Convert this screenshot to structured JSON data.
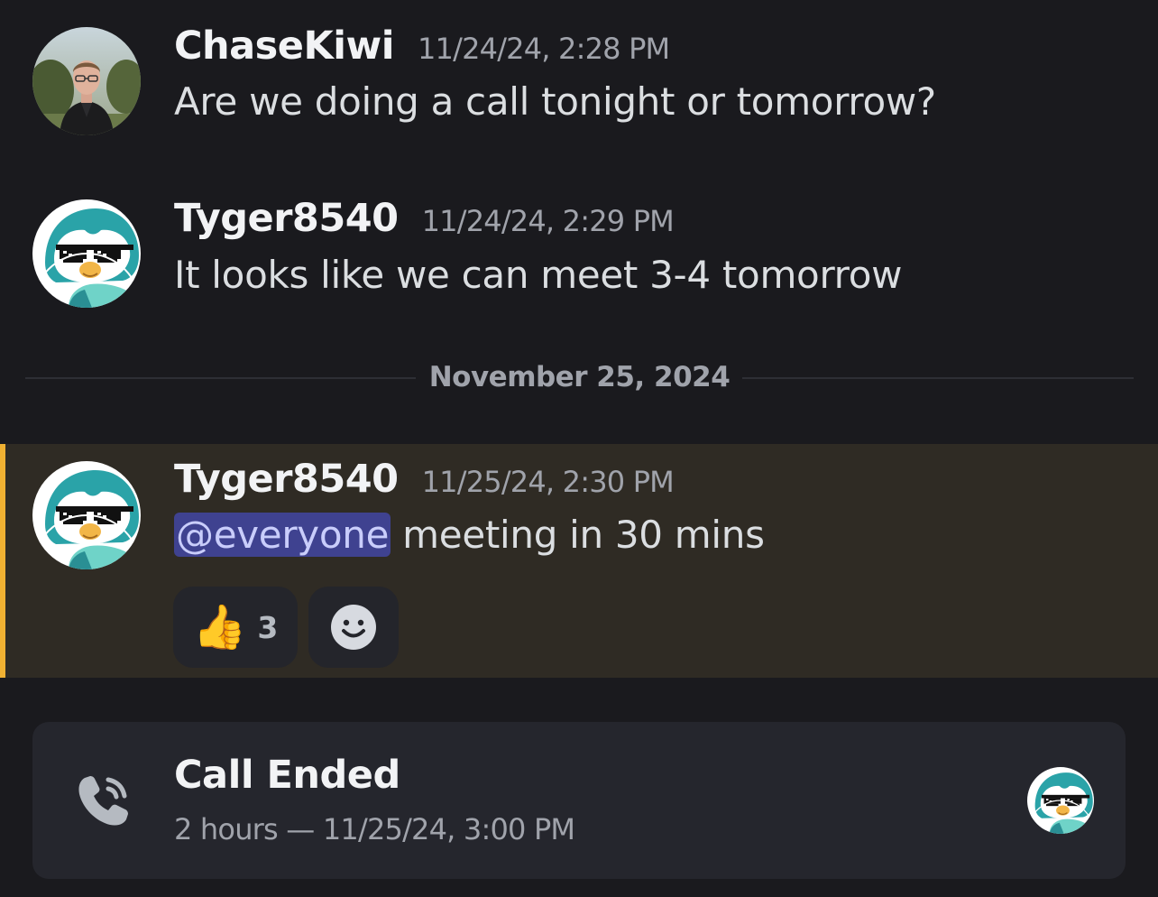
{
  "messages": [
    {
      "username": "ChaseKiwi",
      "timestamp": "11/24/24, 2:28 PM",
      "text": "Are we doing a call tonight or tomorrow?",
      "avatar": "person-photo-avatar"
    },
    {
      "username": "Tyger8540",
      "timestamp": "11/24/24, 2:29 PM",
      "text": "It looks like we can meet 3-4 tomorrow",
      "avatar": "penguin-sunglasses-avatar"
    },
    {
      "username": "Tyger8540",
      "timestamp": "11/25/24, 2:30 PM",
      "mention": "@everyone",
      "text": " meeting in 30 mins",
      "avatar": "penguin-sunglasses-avatar"
    }
  ],
  "date_divider": "November 25, 2024",
  "reactions": [
    {
      "emoji": "👍",
      "icon": "thumbs-up-emoji",
      "count": "3"
    },
    {
      "icon": "add-reaction-smiley-icon"
    }
  ],
  "call": {
    "title": "Call Ended",
    "subtitle": "2 hours — 11/25/24, 3:00 PM",
    "icon": "phone-call-icon"
  },
  "colors": {
    "background": "#1a1a1e",
    "highlight_background": "#2f2b24",
    "highlight_bar": "#f0b132",
    "mention_background": "#3f4290",
    "mention_text": "#c9cdfb",
    "card_background": "#25262d"
  }
}
